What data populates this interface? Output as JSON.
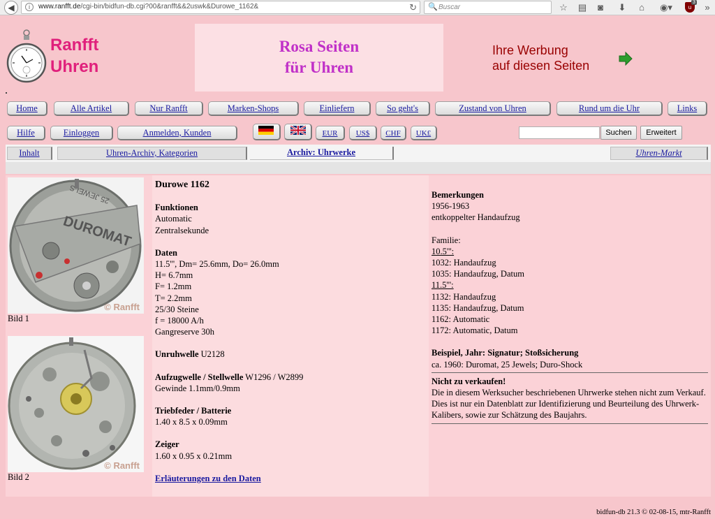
{
  "browser": {
    "url_host": "www.ranfft.de",
    "url_path": "/cgi-bin/bidfun-db.cgi?00&ranfft&&2uswk&Durowe_1162&",
    "search_placeholder": "Buscar",
    "ublock_count": "3"
  },
  "header": {
    "brand_line1": "Ranfft",
    "brand_line2": "Uhren",
    "rosa_line1": "Rosa Seiten",
    "rosa_line2": "für Uhren",
    "ad_line1": "Ihre Werbung",
    "ad_line2": "auf diesen Seiten"
  },
  "nav_main": [
    "Home",
    "Alle Artikel",
    "Nur Ranfft",
    "Marken-Shops",
    "Einliefern",
    "So geht's",
    "Zustand von Uhren",
    "Rund um die Uhr",
    "Links"
  ],
  "nav_second": {
    "help": "Hilfe",
    "login": "Einloggen",
    "register": "Anmelden, Kunden",
    "currencies": [
      "EUR",
      "US$",
      "CHF",
      "UK£"
    ],
    "search_button": "Suchen",
    "advanced_button": "Erweitert"
  },
  "tabs": {
    "contents": "Inhalt",
    "archive_categories": "Uhren-Archiv, Kategorien",
    "archive_movements": "Archiv: Uhrwerke",
    "market": "Uhren-Markt"
  },
  "images": {
    "caption1": "Bild 1",
    "caption2": "Bild 2",
    "copyright": "© Ranfft",
    "movement_text": "DUROMAT",
    "jewels_text": "25 JEWELS"
  },
  "movement": {
    "title": "Durowe 1162",
    "functions_label": "Funktionen",
    "functions": [
      "Automatic",
      "Zentralsekunde"
    ],
    "data_label": "Daten",
    "data": [
      "11.5''', Dm= 25.6mm, Do= 26.0mm",
      "H= 6.7mm",
      "F= 1.2mm",
      "T= 2.2mm",
      "25/30 Steine",
      "f = 18000 A/h",
      "Gangreserve 30h"
    ],
    "balance_label": "Unruhwelle",
    "balance_value": "U2128",
    "winding_label": "Aufzugwelle / Stellwelle",
    "winding_value": "W1296 / W2899",
    "thread": "Gewinde 1.1mm/0.9mm",
    "mainspring_label": "Triebfeder / Batterie",
    "mainspring_value": "1.40 x 8.5 x 0.09mm",
    "hands_label": "Zeiger",
    "hands_value": "1.60 x 0.95 x 0.21mm",
    "explain_link": "Erläuterungen zu den Daten"
  },
  "remarks": {
    "label": "Bemerkungen",
    "lines": [
      "1956-1963",
      "entkoppelter Handaufzug"
    ],
    "family_label": "Familie:",
    "group1": "10.5''':",
    "group1_items": [
      "1032: Handaufzug",
      "1035: Handaufzug, Datum"
    ],
    "group2": "11.5''':",
    "group2_items": [
      "1132: Handaufzug",
      "1135: Handaufzug, Datum",
      "1162: Automatic",
      "1172: Automatic, Datum"
    ],
    "example_label": "Beispiel, Jahr: Signatur; Stoßsicherung",
    "example_value": "ca. 1960: Duromat, 25 Jewels; Duro-Shock",
    "notforsale_label": "Nicht zu verkaufen!",
    "notforsale_text": "Die in diesem Werksucher beschriebenen Uhrwerke stehen nicht zum Verkauf. Dies ist nur ein Datenblatt zur Identifizierung und Beurteilung des Uhrwerk-Kalibers, sowie zur Schätzung des Baujahrs."
  },
  "footer": "bidfun-db 21.3 © 02-08-15, mtr-Ranfft"
}
